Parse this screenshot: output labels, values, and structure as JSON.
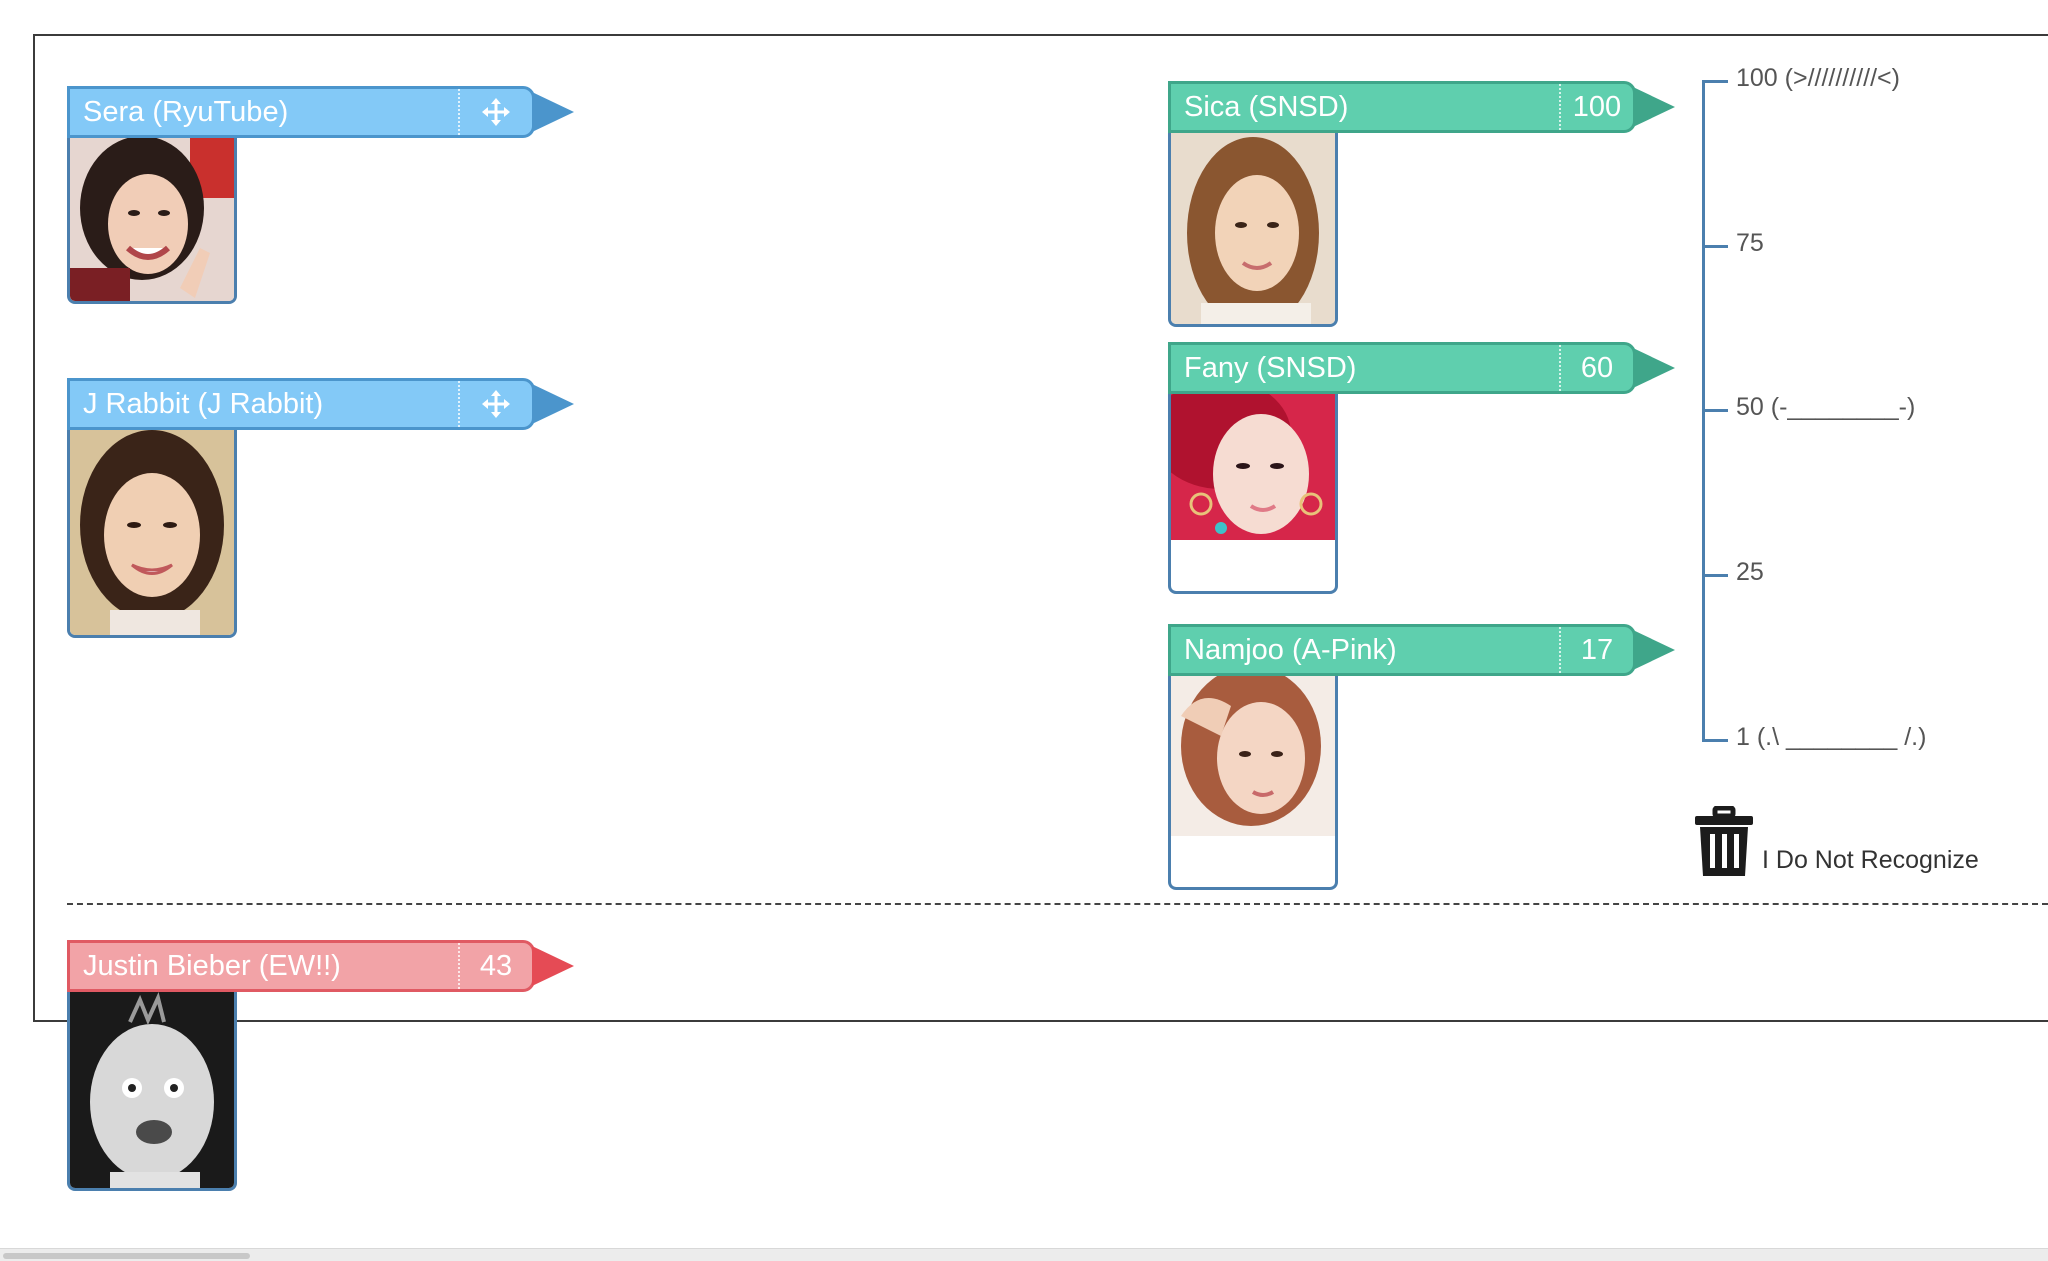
{
  "colors": {
    "unranked": "#83c9f7",
    "ranked": "#5fcfae",
    "disliked": "#f2a3a7"
  },
  "unranked": [
    {
      "label": "Sera (RyuTube)",
      "icon": "move-icon"
    },
    {
      "label": "J Rabbit (J Rabbit)",
      "icon": "move-icon"
    }
  ],
  "ranked": [
    {
      "label": "Sica (SNSD)",
      "score": "100"
    },
    {
      "label": "Fany (SNSD)",
      "score": "60"
    },
    {
      "label": "Namjoo (A-Pink)",
      "score": "17"
    }
  ],
  "disliked": [
    {
      "label": "Justin Bieber (EW!!)",
      "score": "43"
    }
  ],
  "scale": {
    "ticks": [
      {
        "value": 100,
        "label": "100 (>//////////<)"
      },
      {
        "value": 75,
        "label": "75"
      },
      {
        "value": 50,
        "label": "50 (-________-)"
      },
      {
        "value": 25,
        "label": "25"
      },
      {
        "value": 1,
        "label": "1 (.\\ ________ /.)"
      }
    ]
  },
  "trash": {
    "label": "I Do Not Recognize",
    "icon": "trash-icon"
  }
}
